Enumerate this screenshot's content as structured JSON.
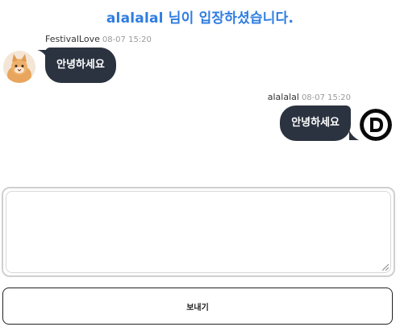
{
  "notice": {
    "text": "alalalal 님이 입장하셨습니다."
  },
  "messages": [
    {
      "sender": "FestivalLove",
      "time": "08-07 15:20",
      "text": "안녕하세요",
      "side": "left",
      "avatar": "cat-avatar-icon"
    },
    {
      "sender": "alalalal",
      "time": "08-07 15:20",
      "text": "안녕하세요",
      "side": "right",
      "avatar": "d-logo-avatar-icon"
    }
  ],
  "composer": {
    "value": "",
    "placeholder": ""
  },
  "send_button": {
    "label": "보내기"
  },
  "colors": {
    "notice": "#2f7de1",
    "bubble": "#2b3340",
    "bubble_text": "#ffffff"
  }
}
